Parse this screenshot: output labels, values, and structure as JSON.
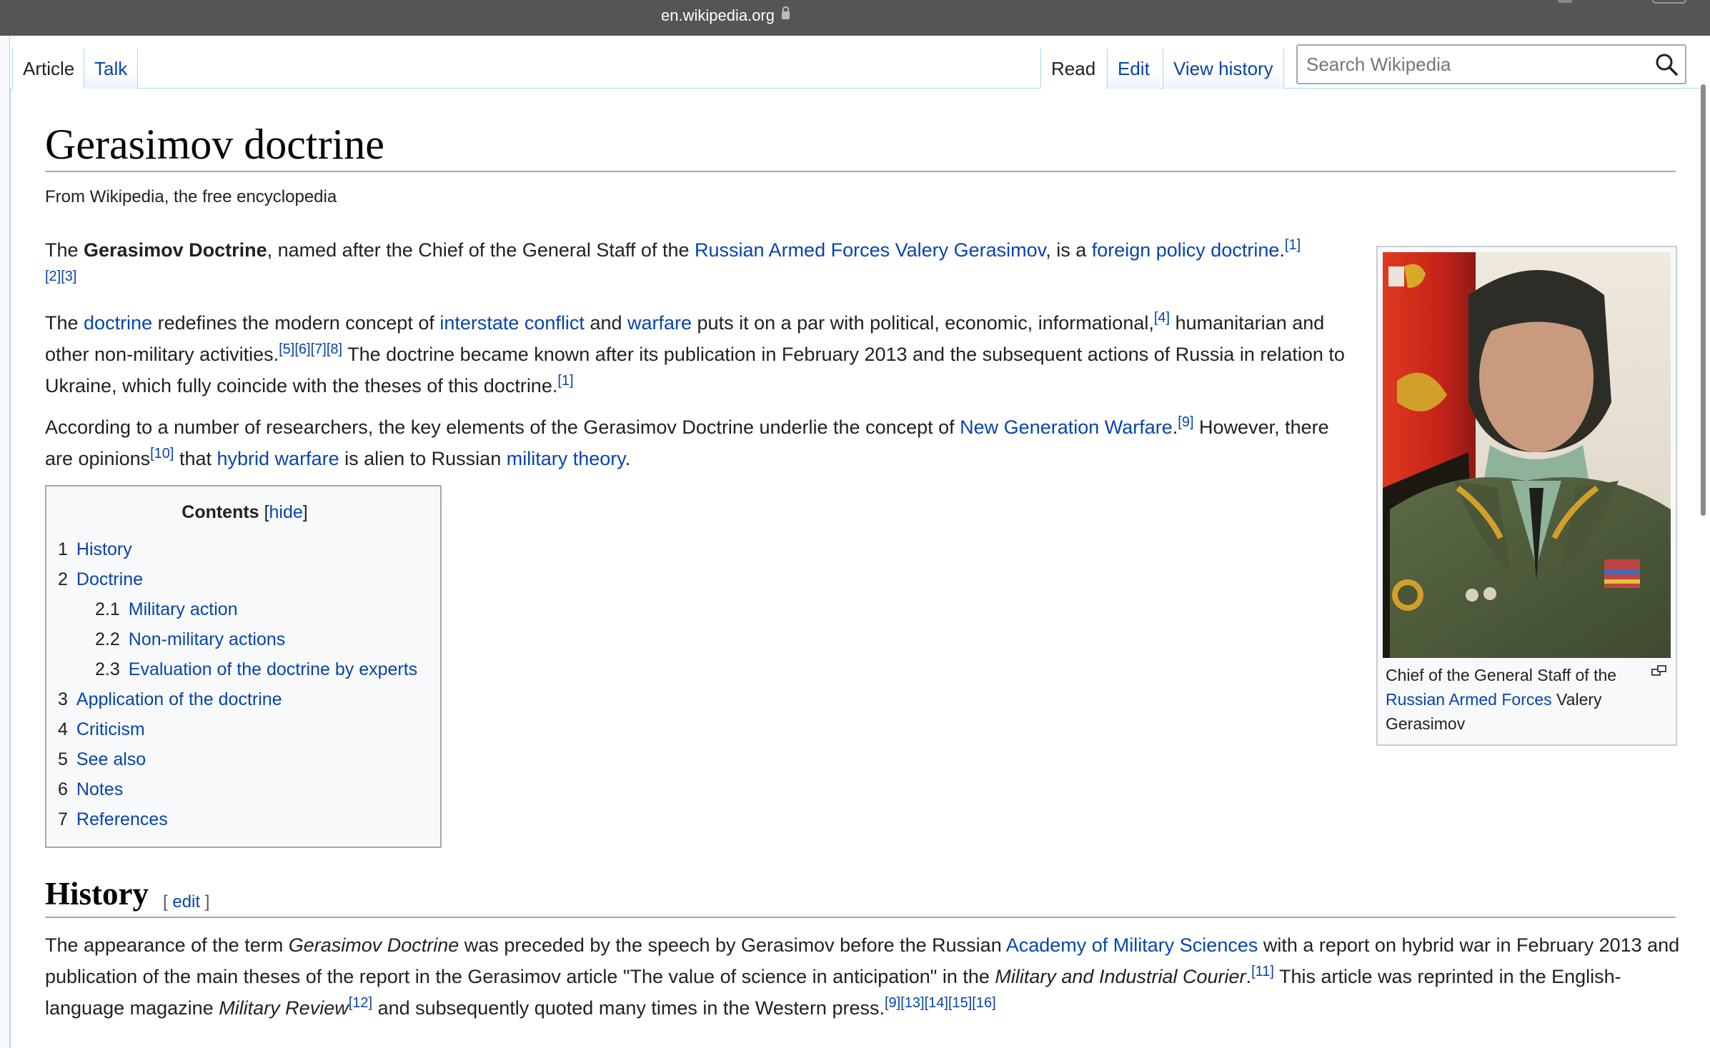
{
  "browser": {
    "url": "en.wikipedia.org"
  },
  "tabs": {
    "article": "Article",
    "talk": "Talk",
    "read": "Read",
    "edit": "Edit",
    "view_history": "View history"
  },
  "search": {
    "placeholder": "Search Wikipedia",
    "value": ""
  },
  "article": {
    "title": "Gerasimov doctrine",
    "tagline": "From Wikipedia, the free encyclopedia",
    "p1": [
      {
        "t": "The "
      },
      {
        "t": "Gerasimov Doctrine",
        "b": true
      },
      {
        "t": ", named after the Chief of the General Staff of the "
      },
      {
        "t": "Russian Armed Forces",
        "link": true
      },
      {
        "t": " "
      },
      {
        "t": "Valery Gerasimov",
        "link": true
      },
      {
        "t": ", is a "
      },
      {
        "t": "foreign policy doctrine",
        "link": true
      },
      {
        "t": "."
      },
      {
        "t": "[1][2][3]",
        "sup": true
      }
    ],
    "p2": [
      {
        "t": "The "
      },
      {
        "t": "doctrine",
        "link": true
      },
      {
        "t": " redefines the modern concept of "
      },
      {
        "t": "interstate conflict",
        "link": true
      },
      {
        "t": " and "
      },
      {
        "t": "warfare",
        "link": true
      },
      {
        "t": " puts it on a par with political, economic, informational,"
      },
      {
        "t": "[4]",
        "sup": true
      },
      {
        "t": " humanitarian and other non-military activities."
      },
      {
        "t": "[5][6][7][8]",
        "sup": true
      },
      {
        "t": " The doctrine became known after its publication in February 2013 and the subsequent actions of Russia in relation to Ukraine, which fully coincide with the theses of this doctrine."
      },
      {
        "t": "[1]",
        "sup": true
      }
    ],
    "p3": [
      {
        "t": "According to a number of researchers, the key elements of the Gerasimov Doctrine underlie the concept of "
      },
      {
        "t": "New Generation Warfare",
        "link": true
      },
      {
        "t": "."
      },
      {
        "t": "[9]",
        "sup": true
      },
      {
        "t": " However, there are opinions"
      },
      {
        "t": "[10]",
        "sup": true
      },
      {
        "t": " that "
      },
      {
        "t": "hybrid warfare",
        "link": true
      },
      {
        "t": " is alien to Russian "
      },
      {
        "t": "military theory",
        "link": true
      },
      {
        "t": "."
      }
    ]
  },
  "infobox": {
    "caption": [
      {
        "t": "Chief of the General Staff of the "
      },
      {
        "t": "Russian Armed Forces",
        "link": true
      },
      {
        "t": " Valery Gerasimov"
      }
    ]
  },
  "toc": {
    "title": "Contents",
    "toggle": "hide",
    "items": [
      {
        "num": "1",
        "label": "History",
        "level": 1
      },
      {
        "num": "2",
        "label": "Doctrine",
        "level": 1
      },
      {
        "num": "2.1",
        "label": "Military action",
        "level": 2
      },
      {
        "num": "2.2",
        "label": "Non-military actions",
        "level": 2
      },
      {
        "num": "2.3",
        "label": "Evaluation of the doctrine by experts",
        "level": 2
      },
      {
        "num": "3",
        "label": "Application of the doctrine",
        "level": 1
      },
      {
        "num": "4",
        "label": "Criticism",
        "level": 1
      },
      {
        "num": "5",
        "label": "See also",
        "level": 1
      },
      {
        "num": "6",
        "label": "Notes",
        "level": 1
      },
      {
        "num": "7",
        "label": "References",
        "level": 1
      }
    ]
  },
  "history": {
    "heading": "History",
    "edit_label": "edit",
    "p1": [
      {
        "t": "The appearance of the term "
      },
      {
        "t": "Gerasimov Doctrine",
        "i": true
      },
      {
        "t": " was preceded by the speech by Gerasimov before the Russian "
      },
      {
        "t": "Academy of Military Sciences",
        "link": true
      },
      {
        "t": " with a report on hybrid war in February 2013 and publication of the main theses of the report in the Gerasimov article \"The value of science in anticipation\" in the "
      },
      {
        "t": "Military and Industrial Courier",
        "i": true
      },
      {
        "t": "."
      },
      {
        "t": "[11]",
        "sup": true
      },
      {
        "t": " This article was reprinted in the English-language magazine "
      },
      {
        "t": "Military Review",
        "i": true
      },
      {
        "t": "[12]",
        "sup": true
      },
      {
        "t": " and subsequently quoted many times in the Western press."
      },
      {
        "t": "[9][13][14][15][16]",
        "sup": true
      }
    ]
  },
  "colors": {
    "link": "#0645ad",
    "text": "#202122",
    "border": "#a2a9b1",
    "tab_border": "#a7d7f9"
  }
}
